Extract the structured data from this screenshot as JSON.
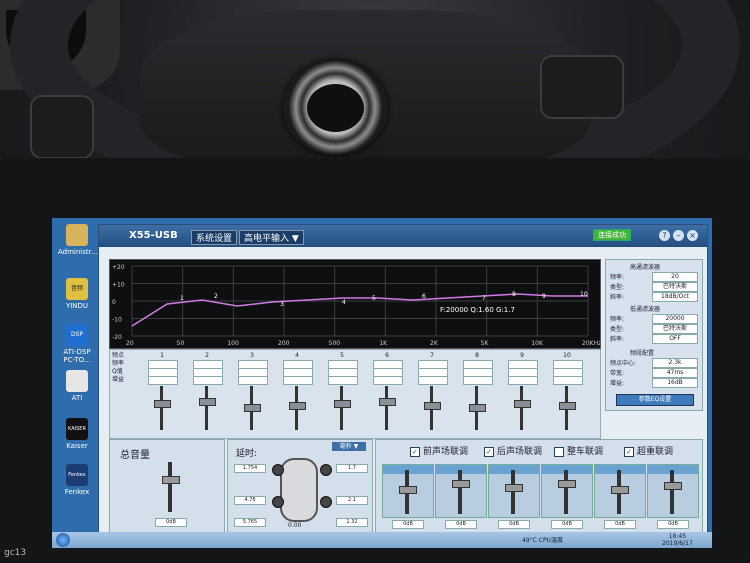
{
  "desktop": {
    "icons": [
      {
        "label": "Administr...",
        "color": "#d9b35c"
      },
      {
        "label": "YINDU",
        "color": "#e0c040",
        "badge": "音频"
      },
      {
        "label": "ATI-DSP PC-TO...",
        "color": "#1e6fd0",
        "badge": "DSP"
      },
      {
        "label": "ATI",
        "color": "#e6e6e6"
      },
      {
        "label": "Kaiser",
        "color": "#111111",
        "badge": "KAISER"
      },
      {
        "label": "Fenkex",
        "color": "#1c3c74",
        "badge": "Fenkex"
      }
    ]
  },
  "app": {
    "title": "X55-USB",
    "tab_settings": "系统设置",
    "input_mode": "高电平输入",
    "connect_status": "连接成功",
    "graph": {
      "y_ticks": [
        "+20",
        "+10",
        "0",
        "-10",
        "-20"
      ],
      "x_ticks": [
        "20",
        "50",
        "100",
        "200",
        "500",
        "1K",
        "2K",
        "5K",
        "10K",
        "20KHz"
      ],
      "curve_labels": [
        "1",
        "2",
        "3",
        "4",
        "5",
        "6",
        "7",
        "8",
        "9",
        "10"
      ],
      "readout": "F:20000 Q:1.60 G:1.7"
    },
    "side_panel": {
      "highpass_title": "高通滤波器",
      "freq_label": "频率:",
      "freq_value": "20",
      "type_label": "类型:",
      "type_value": "巴特沃斯",
      "slope_label": "斜率:",
      "slope_value": "18dB/Oct",
      "lowpass_title": "低通滤波器",
      "lp_freq_value": "20000",
      "lp_type_value": "巴特沃斯",
      "lp_slope_value": "OFF",
      "bass_title": "频段配置",
      "bass_freq_label": "频点中心:",
      "bass_freq_value": "2.3k",
      "bass_q_label": "带宽:",
      "bass_q_value": "47ms",
      "bass_gain_label": "增益:",
      "bass_gain_value": "16dB",
      "reset_button": "参数EQ设置"
    },
    "bands": {
      "header_labels": [
        "频点",
        "频率",
        "Q值",
        "增益"
      ],
      "numbers": [
        "1",
        "2",
        "3",
        "4",
        "5",
        "6",
        "7",
        "8",
        "9",
        "10"
      ]
    },
    "master": {
      "label": "总音量",
      "value": "0dB"
    },
    "delay": {
      "label": "延时:",
      "unit_select": "毫秒",
      "values": [
        "1.754",
        "1.7",
        "4.78",
        "2.1",
        "5.765",
        "1.32"
      ],
      "bottom_value": "0.00"
    },
    "channels": {
      "links": [
        {
          "label": "前声场联调",
          "checked": true
        },
        {
          "label": "后声场联调",
          "checked": true
        },
        {
          "label": "整车联调",
          "checked": false
        },
        {
          "label": "超重联调",
          "checked": true
        }
      ],
      "values": [
        "0dB",
        "0dB",
        "0dB",
        "0dB",
        "0dB",
        "0dB"
      ]
    }
  },
  "taskbar": {
    "time": "18:45",
    "date": "2019/6/17",
    "cpu_temp": "49°C",
    "cpu_label": "CPU温度"
  },
  "watermark": "gc13"
}
